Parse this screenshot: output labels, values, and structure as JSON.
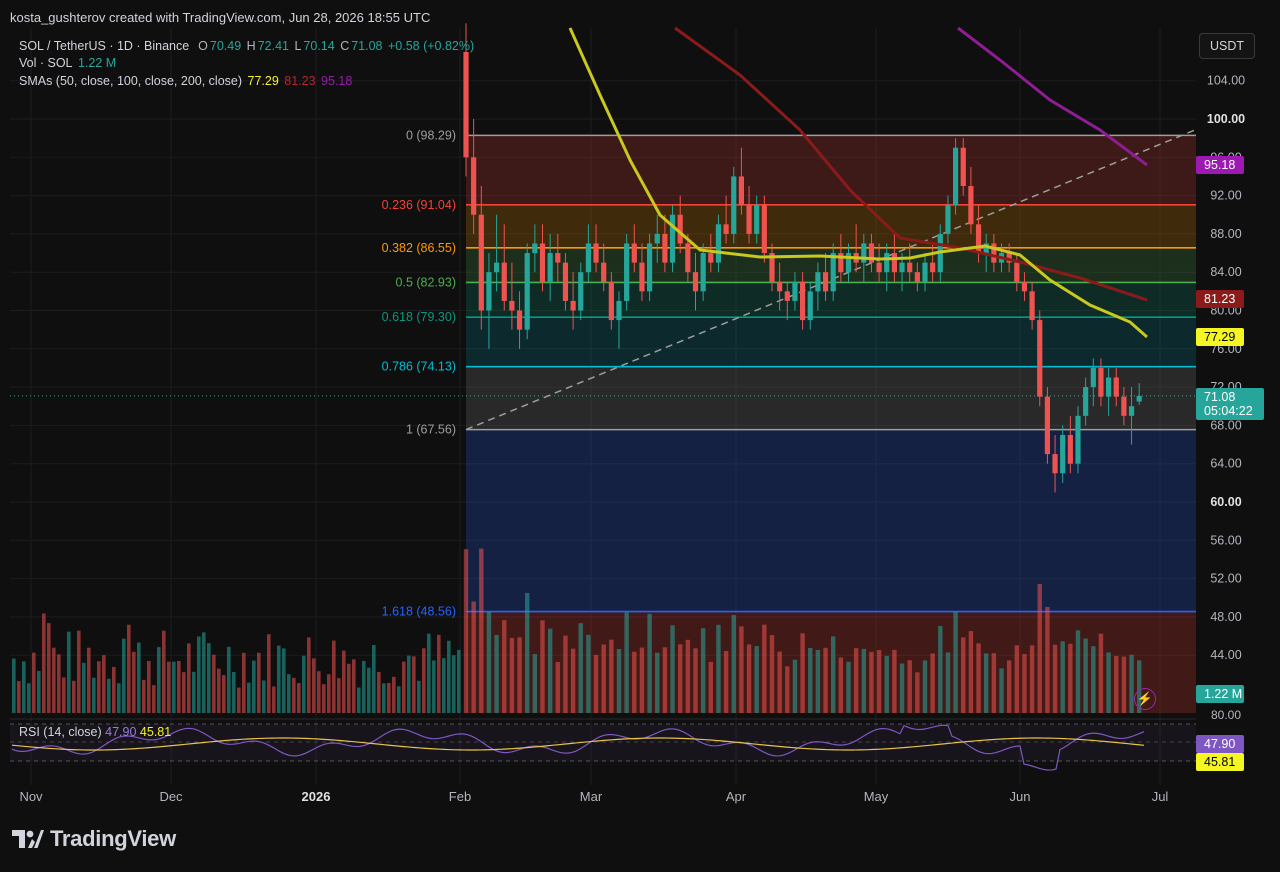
{
  "header": {
    "text": "kosta_gushterov created with TradingView.com, Jun 28, 2026 18:55 UTC"
  },
  "legend": {
    "symbol": "SOL / TetherUS · 1D · Binance",
    "o_label": "O",
    "o": "70.49",
    "h_label": "H",
    "h": "72.41",
    "l_label": "L",
    "l": "70.14",
    "c_label": "C",
    "c": "71.08",
    "change": "+0.58 (+0.82%)",
    "vol_label": "Vol · SOL",
    "vol": "1.22 M",
    "sma_label": "SMAs (50, close, 100, close, 200, close)",
    "sma50": "77.29",
    "sma100": "81.23",
    "sma200": "95.18"
  },
  "rsi_legend": {
    "label": "RSI (14, close)",
    "rsi": "47.90",
    "rsi_ma": "45.81"
  },
  "currency": "USDT",
  "brand": "TradingView",
  "badges": {
    "sma200": "95.18",
    "sma100": "81.23",
    "sma50": "77.29",
    "price": "71.08",
    "countdown": "05:04:22",
    "volume": "1.22 M",
    "rsi": "47.90",
    "rsi_ma": "45.81"
  },
  "colors": {
    "up": "#26a69a",
    "down": "#ef5350",
    "sma50": "#c8c81e",
    "sma100": "#8b1a1a",
    "sma200": "#8e1d94",
    "rsi": "#7e57c2",
    "rsi_ma": "#e7c24a"
  },
  "icons": {
    "bolt": "lightning-icon",
    "logo": "tradingview-logo-icon"
  },
  "chart_data": {
    "type": "candlestick",
    "symbol": "SOL / TetherUS",
    "interval": "1D",
    "exchange": "Binance",
    "y_axis_ticks": [
      "104.00",
      "100.00",
      "96.00",
      "92.00",
      "88.00",
      "84.00",
      "80.00",
      "76.00",
      "72.00",
      "68.00",
      "64.00",
      "60.00",
      "56.00",
      "52.00",
      "48.00",
      "44.00"
    ],
    "ylim": [
      41.5,
      110
    ],
    "x_axis_ticks": [
      "Nov",
      "Dec",
      "2026",
      "Feb",
      "Mar",
      "Apr",
      "May",
      "Jun",
      "Jul"
    ],
    "fibonacci": [
      {
        "level": "0",
        "price": 98.29,
        "label": "0 (98.29)",
        "color": "#9e9e9e"
      },
      {
        "level": "0.236",
        "price": 91.04,
        "label": "0.236 (91.04)",
        "color": "#f44336"
      },
      {
        "level": "0.382",
        "price": 86.55,
        "label": "0.382 (86.55)",
        "color": "#ff9800"
      },
      {
        "level": "0.5",
        "price": 82.93,
        "label": "0.5 (82.93)",
        "color": "#4caf50"
      },
      {
        "level": "0.618",
        "price": 79.3,
        "label": "0.618 (79.30)",
        "color": "#089981"
      },
      {
        "level": "0.786",
        "price": 74.13,
        "label": "0.786 (74.13)",
        "color": "#00bcd4"
      },
      {
        "level": "1",
        "price": 67.56,
        "label": "1 (67.56)",
        "color": "#9e9e9e"
      },
      {
        "level": "1.618",
        "price": 48.56,
        "label": "1.618 (48.56)",
        "color": "#2962ff"
      }
    ],
    "last": {
      "open": 70.49,
      "high": 72.41,
      "low": 70.14,
      "close": 71.08,
      "change": 0.58,
      "change_pct": 0.82,
      "volume": "1.22 M"
    },
    "sma": {
      "sma50": 77.29,
      "sma100": 81.23,
      "sma200": 95.18
    },
    "rsi": {
      "period": 14,
      "value": 47.9,
      "ma": 45.81,
      "levels": [
        70,
        50,
        30
      ]
    },
    "candles": [
      [
        107,
        110,
        94,
        96
      ],
      [
        96,
        100,
        88,
        90
      ],
      [
        90,
        93,
        78,
        80
      ],
      [
        80,
        86,
        76,
        84
      ],
      [
        84,
        90,
        82,
        85
      ],
      [
        85,
        89,
        80,
        81
      ],
      [
        81,
        85,
        78,
        80
      ],
      [
        80,
        82,
        76,
        78
      ],
      [
        78,
        87,
        77,
        86
      ],
      [
        86,
        89,
        84,
        87
      ],
      [
        87,
        89,
        82,
        83
      ],
      [
        83,
        88,
        81,
        86
      ],
      [
        86,
        88,
        83,
        85
      ],
      [
        85,
        86,
        80,
        81
      ],
      [
        81,
        84,
        78,
        80
      ],
      [
        80,
        85,
        79,
        84
      ],
      [
        84,
        89,
        83,
        87
      ],
      [
        87,
        89,
        84,
        85
      ],
      [
        85,
        87,
        82,
        83
      ],
      [
        83,
        84,
        78,
        79
      ],
      [
        79,
        82,
        76,
        81
      ],
      [
        81,
        88,
        80,
        87
      ],
      [
        87,
        89,
        84,
        85
      ],
      [
        85,
        87,
        81,
        82
      ],
      [
        82,
        88,
        81,
        87
      ],
      [
        87,
        90,
        85,
        88
      ],
      [
        88,
        90,
        84,
        85
      ],
      [
        85,
        91,
        84,
        90
      ],
      [
        90,
        92,
        86,
        87
      ],
      [
        87,
        88,
        83,
        84
      ],
      [
        84,
        86,
        80,
        82
      ],
      [
        82,
        87,
        81,
        86
      ],
      [
        86,
        88,
        84,
        85
      ],
      [
        85,
        90,
        84,
        89
      ],
      [
        89,
        92,
        87,
        88
      ],
      [
        88,
        95,
        87,
        94
      ],
      [
        94,
        97,
        90,
        91
      ],
      [
        91,
        93,
        87,
        88
      ],
      [
        88,
        92,
        87,
        91
      ],
      [
        91,
        92,
        85,
        86
      ],
      [
        86,
        87,
        82,
        83
      ],
      [
        83,
        85,
        80,
        82
      ],
      [
        82,
        83,
        79,
        81
      ],
      [
        81,
        84,
        80,
        83
      ],
      [
        83,
        84,
        78,
        79
      ],
      [
        79,
        83,
        78,
        82
      ],
      [
        82,
        85,
        80,
        84
      ],
      [
        84,
        86,
        81,
        82
      ],
      [
        82,
        87,
        81,
        86
      ],
      [
        86,
        88,
        83,
        84
      ],
      [
        84,
        87,
        83,
        86
      ],
      [
        86,
        89,
        84,
        85
      ],
      [
        85,
        88,
        83,
        87
      ],
      [
        87,
        88,
        84,
        85
      ],
      [
        85,
        87,
        83,
        84
      ],
      [
        84,
        87,
        82,
        86
      ],
      [
        86,
        88,
        83,
        84
      ],
      [
        84,
        86,
        82,
        85
      ],
      [
        85,
        87,
        83,
        84
      ],
      [
        84,
        85,
        82,
        83
      ],
      [
        83,
        86,
        82,
        85
      ],
      [
        85,
        87,
        83,
        84
      ],
      [
        84,
        89,
        83,
        88
      ],
      [
        88,
        92,
        87,
        91
      ],
      [
        91,
        98,
        90,
        97
      ],
      [
        97,
        98,
        92,
        93
      ],
      [
        93,
        95,
        88,
        89
      ],
      [
        89,
        91,
        85,
        86
      ],
      [
        86,
        88,
        84,
        87
      ],
      [
        87,
        88,
        84,
        85
      ],
      [
        85,
        87,
        84,
        86
      ],
      [
        86,
        87,
        84,
        85
      ],
      [
        85,
        86,
        82,
        83
      ],
      [
        83,
        84,
        81,
        82
      ],
      [
        82,
        83,
        78,
        79
      ],
      [
        79,
        80,
        70,
        71
      ],
      [
        71,
        72,
        64,
        65
      ],
      [
        65,
        67,
        61,
        63
      ],
      [
        63,
        68,
        62,
        67
      ],
      [
        67,
        69,
        63,
        64
      ],
      [
        64,
        70,
        63,
        69
      ],
      [
        69,
        73,
        68,
        72
      ],
      [
        72,
        75,
        70,
        74
      ],
      [
        74,
        75,
        70,
        71
      ],
      [
        71,
        74,
        69,
        73
      ],
      [
        73,
        74,
        70,
        71
      ],
      [
        71,
        72,
        68,
        69
      ],
      [
        69,
        72,
        66,
        70
      ],
      [
        70.49,
        72.41,
        70.14,
        71.08
      ]
    ]
  }
}
